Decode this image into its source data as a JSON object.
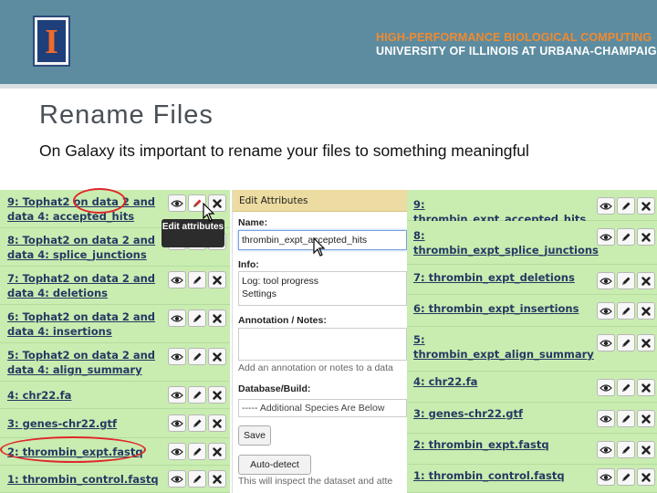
{
  "header": {
    "university_logo_letter": "I",
    "org_line1": "HIGH-PERFORMANCE BIOLOGICAL COMPUTING",
    "org_line2": "UNIVERSITY OF ILLINOIS AT URBANA-CHAMPAIGN"
  },
  "slide": {
    "title": "Rename Files",
    "subtitle": "On Galaxy its important to rename your files to something meaningful"
  },
  "history_left": {
    "items": [
      {
        "label": "9: Tophat2 on data 2 and data 4: accepted_hits"
      },
      {
        "label": "8: Tophat2 on data 2 and data 4: splice_junctions"
      },
      {
        "label": "7: Tophat2 on data 2 and data 4: deletions"
      },
      {
        "label": "6: Tophat2 on data 2 and data 4: insertions"
      },
      {
        "label": "5: Tophat2 on data 2 and data 4: align_summary"
      },
      {
        "label": "4: chr22.fa"
      },
      {
        "label": "3: genes-chr22.gtf"
      },
      {
        "label": "2: thrombin_expt.fastq"
      },
      {
        "label": "1: thrombin_control.fastq"
      }
    ],
    "tooltip": "Edit attributes"
  },
  "edit_attributes": {
    "header": "Edit Attributes",
    "name_label": "Name:",
    "name_value": "thrombin_expt_accepted_hits",
    "info_label": "Info:",
    "info_value_line1": "Log: tool progress",
    "info_value_line2": "Settings",
    "annotation_label": "Annotation / Notes:",
    "annotation_hint": "Add an annotation or notes to a data",
    "database_label": "Database/Build:",
    "database_value": "----- Additional Species Are Below",
    "save_label": "Save",
    "autodetect_label": "Auto-detect",
    "autodetect_hint": "This will inspect the dataset and atte"
  },
  "history_right": {
    "items": [
      {
        "label": "9: thrombin_expt_accepted_hits"
      },
      {
        "label": "8: thrombin_expt_splice_junctions"
      },
      {
        "label": "7: thrombin_expt_deletions"
      },
      {
        "label": "6: thrombin_expt_insertions"
      },
      {
        "label": "5: thrombin_expt_align_summary"
      },
      {
        "label": "4: chr22.fa"
      },
      {
        "label": "3: genes-chr22.gtf"
      },
      {
        "label": "2: thrombin_expt.fastq"
      },
      {
        "label": "1: thrombin_control.fastq"
      }
    ]
  },
  "icons": {
    "view": "eye-icon",
    "edit": "pencil-icon",
    "delete": "x-icon"
  },
  "colors": {
    "header_bg": "#5d8ca0",
    "org_accent": "#f28a2e",
    "history_bg": "#cfefb9",
    "link_text": "#233a63",
    "form_header_bg": "#ecdca1",
    "annotation_oval": "#e0262a"
  }
}
